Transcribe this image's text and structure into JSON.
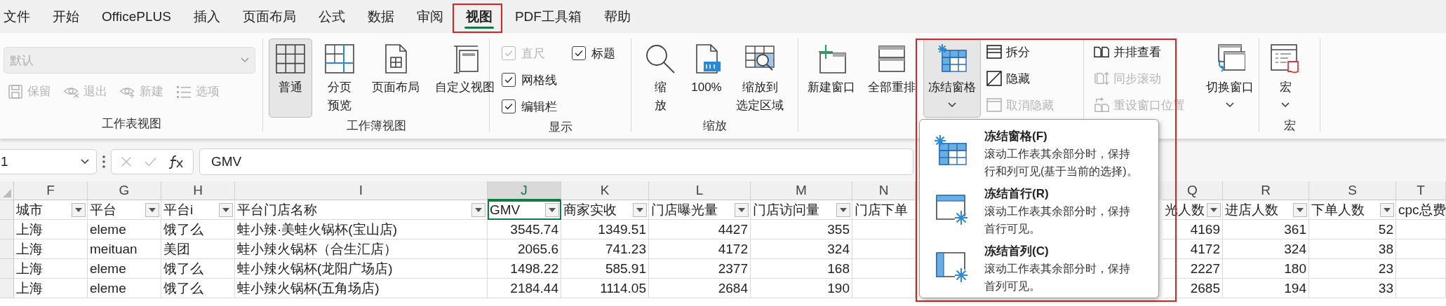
{
  "tabs": [
    {
      "label": "文件",
      "selected": false
    },
    {
      "label": "开始",
      "selected": false
    },
    {
      "label": "OfficePLUS",
      "selected": false
    },
    {
      "label": "插入",
      "selected": false
    },
    {
      "label": "页面布局",
      "selected": false
    },
    {
      "label": "公式",
      "selected": false
    },
    {
      "label": "数据",
      "selected": false
    },
    {
      "label": "审阅",
      "selected": false
    },
    {
      "label": "视图",
      "selected": true
    },
    {
      "label": "PDF工具箱",
      "selected": false
    },
    {
      "label": "帮助",
      "selected": false
    }
  ],
  "sheet_view": {
    "label": "工作表视图",
    "view": {
      "value": "默认",
      "disabled": true
    },
    "actions": [
      {
        "label": "保留",
        "disabled": true
      },
      {
        "label": "退出",
        "disabled": true
      },
      {
        "label": "新建",
        "disabled": true
      },
      {
        "label": "选项",
        "disabled": true
      }
    ]
  },
  "workbook_views": {
    "label": "工作簿视图",
    "buttons": [
      {
        "lines": [
          "普通"
        ],
        "selected": true
      },
      {
        "lines": [
          "分页",
          "预览"
        ],
        "selected": false
      },
      {
        "lines": [
          "页面布局"
        ],
        "selected": false
      },
      {
        "lines": [
          "自定义视图"
        ],
        "selected": false
      }
    ]
  },
  "show": {
    "label": "显示",
    "options": [
      {
        "label": "直尺",
        "checked": true,
        "disabled": true
      },
      {
        "label": "标题",
        "checked": true,
        "disabled": false
      },
      {
        "label": "网格线",
        "checked": true,
        "disabled": false
      },
      {
        "label": "编辑栏",
        "checked": true,
        "disabled": false
      }
    ]
  },
  "zoom": {
    "label": "缩放",
    "buttons": [
      {
        "lines": [
          "缩",
          "放"
        ]
      },
      {
        "lines": [
          "100%"
        ]
      },
      {
        "lines": [
          "缩放到",
          "选定区域"
        ]
      }
    ]
  },
  "window": {
    "buttons": [
      {
        "label": "新建窗口",
        "pressed": false
      },
      {
        "label": "全部重排",
        "pressed": false
      },
      {
        "label": "冻结窗格",
        "pressed": true
      }
    ],
    "commands": [
      {
        "label": "拆分",
        "disabled": false
      },
      {
        "label": "隐藏",
        "disabled": false
      },
      {
        "label": "取消隐藏",
        "disabled": true
      },
      {
        "label": "并排查看",
        "disabled": false
      },
      {
        "label": "同步滚动",
        "disabled": true
      },
      {
        "label": "重设窗口位置",
        "disabled": true
      }
    ],
    "switch": {
      "label": "切换窗口"
    }
  },
  "macros": {
    "label": "宏",
    "button": "宏"
  },
  "formula_bar": {
    "name_box": "1",
    "formula": "GMV"
  },
  "sheet": {
    "columns": [
      {
        "letter": "F",
        "selected": false,
        "header": "城市",
        "filter": true,
        "values": [
          "上海",
          "上海",
          "上海",
          "上海"
        ]
      },
      {
        "letter": "G",
        "selected": false,
        "header": "平台",
        "filter": true,
        "values": [
          "eleme",
          "meituan",
          "eleme",
          "eleme"
        ]
      },
      {
        "letter": "H",
        "selected": false,
        "header": "平台i",
        "filter": true,
        "values": [
          "饿了么",
          "美团",
          "饿了么",
          "饿了么"
        ]
      },
      {
        "letter": "I",
        "selected": false,
        "header": "平台门店名称",
        "filter": true,
        "values": [
          "蛙小辣·美蛙火锅杯(宝山店)",
          "蛙小辣火锅杯（合生汇店）",
          "蛙小辣火锅杯(龙阳广场店)",
          "蛙小辣火锅杯(五角场店)"
        ]
      },
      {
        "letter": "J",
        "selected": true,
        "header": "GMV",
        "filter": true,
        "values": [
          "3545.74",
          "2065.6",
          "1498.22",
          "2184.44"
        ]
      },
      {
        "letter": "K",
        "selected": false,
        "header": "商家实收",
        "filter": true,
        "values": [
          "1349.51",
          "741.23",
          "585.91",
          "1114.05"
        ]
      },
      {
        "letter": "L",
        "selected": false,
        "header": "门店曝光量",
        "filter": true,
        "values": [
          "4427",
          "4172",
          "2377",
          "2684"
        ]
      },
      {
        "letter": "M",
        "selected": false,
        "header": "门店访问量",
        "filter": true,
        "values": [
          "355",
          "324",
          "168",
          "190"
        ]
      },
      {
        "letter": "N",
        "selected": false,
        "header": "门店下单",
        "filter": false
      },
      {
        "letter": "Q",
        "selected": false,
        "header": "光人数",
        "filter": true,
        "values": [
          "4169",
          "4172",
          "2227",
          "2685"
        ]
      },
      {
        "letter": "R",
        "selected": false,
        "header": "进店人数",
        "filter": true,
        "values": [
          "361",
          "324",
          "180",
          "194"
        ]
      },
      {
        "letter": "S",
        "selected": false,
        "header": "下单人数",
        "filter": true,
        "values": [
          "52",
          "38",
          "23",
          "33"
        ]
      },
      {
        "letter": "T",
        "selected": false,
        "header": "cpc总费",
        "filter": false
      }
    ]
  },
  "freeze_menu": {
    "items": [
      {
        "title": "冻结窗格(F)",
        "description": [
          "滚动工作表其余部分时，保持",
          "行和列可见(基于当前的选择)。"
        ]
      },
      {
        "title": "冻结首行(R)",
        "description": [
          "滚动工作表其余部分时，保持",
          "首行可见。"
        ]
      },
      {
        "title": "冻结首列(C)",
        "description": [
          "滚动工作表其余部分时，保持",
          "首列可见。"
        ]
      }
    ]
  }
}
